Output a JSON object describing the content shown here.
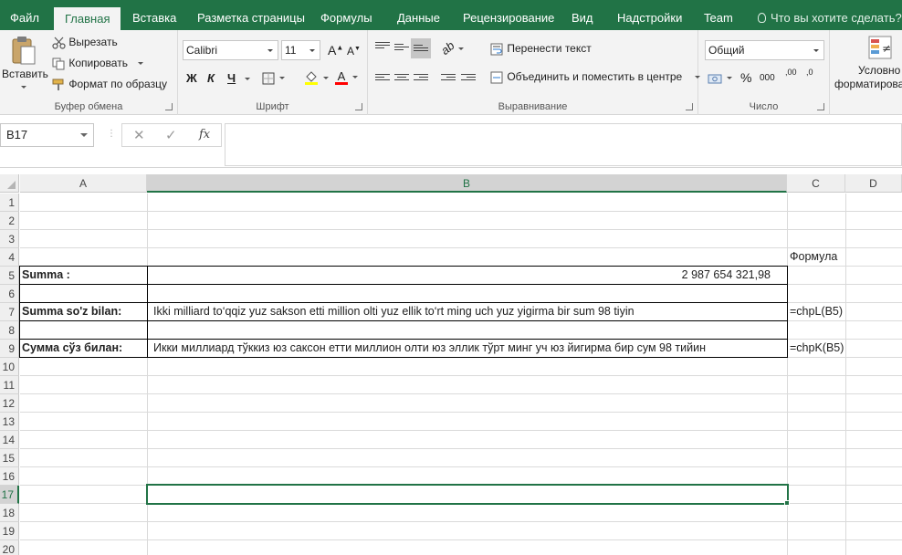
{
  "tabs": [
    "Файл",
    "Главная",
    "Вставка",
    "Разметка страницы",
    "Формулы",
    "Данные",
    "Рецензирование",
    "Вид",
    "Надстройки",
    "Team"
  ],
  "tell_me": "Что вы хотите сделать?",
  "clipboard": {
    "paste": "Вставить",
    "cut": "Вырезать",
    "copy": "Копировать",
    "format_painter": "Формат по образцу",
    "label": "Буфер обмена"
  },
  "font": {
    "name": "Calibri",
    "size": "11",
    "bold": "Ж",
    "italic": "К",
    "underline": "Ч",
    "grow": "A",
    "shrink": "A",
    "color_letter": "A",
    "label": "Шрифт",
    "fill_color": "#ffff00",
    "text_color": "#ff0000"
  },
  "alignment": {
    "wrap": "Перенести текст",
    "merge": "Объединить и поместить в центре",
    "label": "Выравнивание"
  },
  "number": {
    "format": "Общий",
    "percent": "%",
    "thousands": "000",
    "inc_decimal": ",00",
    "dec_decimal": ",0",
    "label": "Число"
  },
  "styles": {
    "conditional_line1": "Условно",
    "conditional_line2": "форматирова"
  },
  "formula_bar": {
    "name_box": "B17",
    "cancel": "✕",
    "enter": "✓",
    "fx": "fx",
    "value": ""
  },
  "columns": [
    "A",
    "B",
    "C",
    "D"
  ],
  "rows": [
    "1",
    "2",
    "3",
    "4",
    "5",
    "6",
    "7",
    "8",
    "9",
    "10",
    "11",
    "12",
    "13",
    "14",
    "15",
    "16",
    "17",
    "18",
    "19",
    "20"
  ],
  "cells": {
    "c4": "Формула",
    "a5": "Summa :",
    "b5": "2 987 654 321,98",
    "a7": "Summa so'z bilan:",
    "b7": "Ikki  milliard   to‘qqiz yuz sakson etti million   olti yuz ellik to‘rt ming  uch yuz yigirma bir sum  98 tiyin",
    "c7": "=chpL(B5)",
    "a9": "Сумма сўз билан:",
    "b9": "Икки  миллиард  тўккиз юз саксон етти миллион  олти юз эллик тўрт минг  уч юз йигирма бир сум  98 тийин",
    "c9": "=chpK(B5)"
  },
  "colors": {
    "accent": "#217346"
  }
}
